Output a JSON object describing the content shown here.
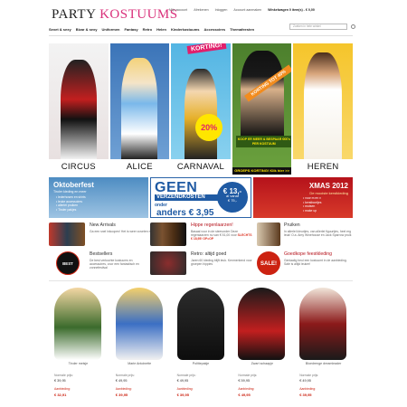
{
  "header": {
    "logo_part1": "PARTY ",
    "logo_part2": "KOSTUUMS",
    "links": [
      "Mijn account",
      "Afrekenen",
      "Inloggen",
      "Account aanmaken"
    ],
    "cart": "Winkelwagen 0 item(s) - € 0,00",
    "search_placeholder": "Zoeken in hele winkel"
  },
  "nav": [
    "Sexet & sexy",
    "Bizar & sexy",
    "Uniformen",
    "Fantasy",
    "Retro",
    "Helen",
    "Kinderkostuums",
    "Accessoires",
    "Themafeesten"
  ],
  "categories": [
    {
      "label": "CIRCUS"
    },
    {
      "label": "ALICE"
    },
    {
      "label": "CARNAVAL",
      "badge": "KORTING!",
      "pct": "20%"
    },
    {
      "label": "",
      "sash": "KORTING TOT 40%",
      "koop": "KOOP ER MEER & BESPAAR €€€'s PER KOSTUUM",
      "groeps": "GROEPS KORTING! Klik hier >>"
    },
    {
      "label": "HEREN"
    }
  ],
  "promos": {
    "oktober": {
      "title": "Oktoberfest",
      "sub": "Tiroler kleding en meer",
      "bullets": [
        "• lederhosen en shirts",
        "• leuke accessoires",
        "• allerlei pruiken",
        "• Tiroler pakjes"
      ]
    },
    "geen": {
      "line1": "GEEN",
      "line2": "VERZENDKOSTEN",
      "line3": "onder",
      "price": "anders € 3,95",
      "seal_top": "€ 13,-",
      "seal_mid": "al vanaf",
      "seal_bottom": "€ 75,-"
    },
    "xmas": {
      "title": "XMAS 2012",
      "sub": "De mooiste kerstkleding",
      "bullets": [
        "• voor m en v",
        "• kerstbontjes",
        "• mutsen",
        "• make up"
      ]
    }
  },
  "features": [
    {
      "title": "New Arrivals",
      "desc": "Ga een snel inkoopen! Het is weer zoveten met onze nieuwe collectie."
    },
    {
      "title": "Hippe regenlaarzen!",
      "desc": "Basaal voor in de steevorder Deze regenlaarzen nu van € 51,00 voor",
      "highlight": "SLECHTS € 18,95! OP=OP"
    },
    {
      "title": "Pruiken",
      "desc": "In allerlei kleurtjes, van allerlei figuurtjes, heel erg leuk! O.a. Amy Winehouse en Jack Sparrow pruik"
    },
    {
      "title": "Bestsellers",
      "desc": "De best verkochte kostuums en accessoires, voor een fantastisch en zonnefestival"
    },
    {
      "title": "Retro: altijd goed",
      "desc": "Jaren 60 kleding blijft leuk. Kenmerkend voor groepen hippies"
    },
    {
      "title": "Goedkope feestkleding",
      "desc": "Geniaalig heul een kostuumt in de aanbieding. Sale is altijd leuker!"
    }
  ],
  "badges": {
    "bestseller": "BEST SELLER",
    "sale": "SALE!"
  },
  "products": [
    {
      "name": "Tiroler meisje",
      "normal_label": "Normale prijs:",
      "normal_price": "€ 39,95",
      "sale_label": "Aanbieding:",
      "sale_price": "€ 32,91"
    },
    {
      "name": "Marie Antoinette",
      "normal_label": "Normale prijs:",
      "normal_price": "€ 49,95",
      "sale_label": "Aanbieding:",
      "sale_price": "€ 39,95"
    },
    {
      "name": "Politiepakje",
      "normal_label": "Normale prijs:",
      "normal_price": "€ 49,95",
      "sale_label": "Aanbieding:",
      "sale_price": "€ 39,95"
    },
    {
      "name": "Zwart schaapje",
      "normal_label": "Normale prijs:",
      "normal_price": "€ 59,95",
      "sale_label": "Aanbieding:",
      "sale_price": "€ 49,95"
    },
    {
      "name": "Bloedrenge dreamleader",
      "normal_label": "Normale prijs:",
      "normal_price": "€ 49,95",
      "sale_label": "Aanbieding:",
      "sale_price": "€ 39,95"
    }
  ]
}
